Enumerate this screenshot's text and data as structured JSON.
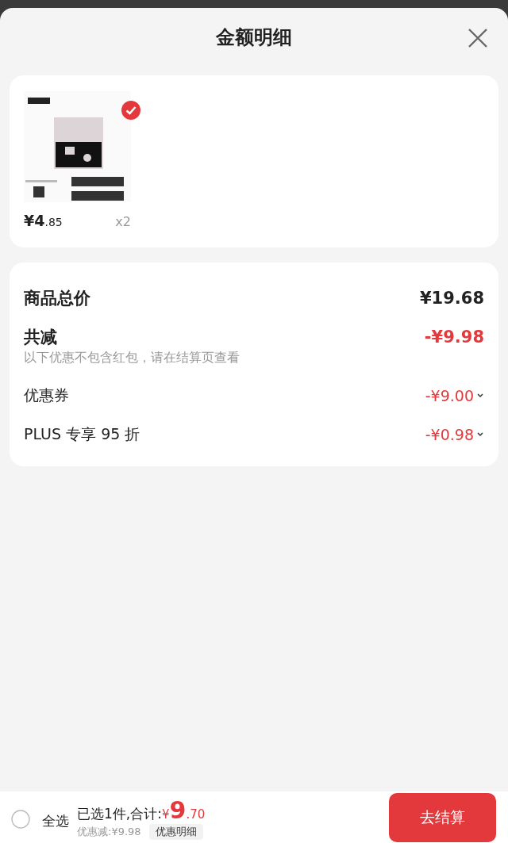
{
  "sheet": {
    "title": "金额明细"
  },
  "products": [
    {
      "kind": "picture",
      "selected": true,
      "price": "¥4.85",
      "quantity": "x2"
    }
  ],
  "summary": [
    {
      "kind": "total",
      "label": "商品总价",
      "amount": "¥19.68"
    },
    {
      "kind": "reduction",
      "label": "共减",
      "amount": "-¥9.98",
      "note": "以下优惠不包含红包，请在结算页查看"
    },
    {
      "kind": "discount",
      "label": "优惠券",
      "amount": "-¥9.00"
    },
    {
      "kind": "discount",
      "label": "PLUS 专享 95 折",
      "amount": "-¥0.98"
    }
  ],
  "bottom_bar": {
    "select_all": {
      "label": "全选",
      "checked": false
    },
    "selected_text": "已选1件,合计:",
    "total": "¥9.70",
    "savings": "优惠减:¥9.98",
    "detail_button": "优惠明细",
    "checkout": "去结算"
  }
}
